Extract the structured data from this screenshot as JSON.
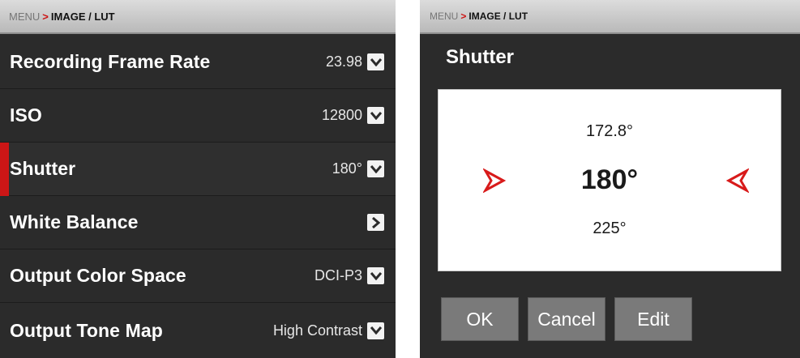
{
  "left": {
    "breadcrumb": {
      "root": "MENU",
      "separator": ">",
      "current": "IMAGE / LUT"
    },
    "rows": [
      {
        "label": "Recording Frame Rate",
        "value": "23.98",
        "control": "chevron-down-icon"
      },
      {
        "label": "ISO",
        "value": "12800",
        "control": "chevron-down-icon"
      },
      {
        "label": "Shutter",
        "value": "180°",
        "control": "chevron-down-icon",
        "active": true
      },
      {
        "label": "White Balance",
        "value": "",
        "control": "chevron-right-icon"
      },
      {
        "label": "Output Color Space",
        "value": "DCI-P3",
        "control": "chevron-down-icon"
      },
      {
        "label": "Output Tone Map",
        "value": "High Contrast",
        "control": "chevron-down-icon"
      }
    ]
  },
  "right": {
    "breadcrumb": {
      "root": "MENU",
      "separator": ">",
      "current": "IMAGE / LUT"
    },
    "title": "Shutter",
    "picker": {
      "previous": "172.8°",
      "current": "180°",
      "next": "225°"
    },
    "buttons": {
      "ok": "OK",
      "cancel": "Cancel",
      "edit": "Edit"
    }
  },
  "colors": {
    "accent_red": "#cc1616",
    "panel_bg": "#2b2b2b",
    "button_bg": "#7a7a7a",
    "breadcrumb_bg": "#c8c8c8"
  }
}
